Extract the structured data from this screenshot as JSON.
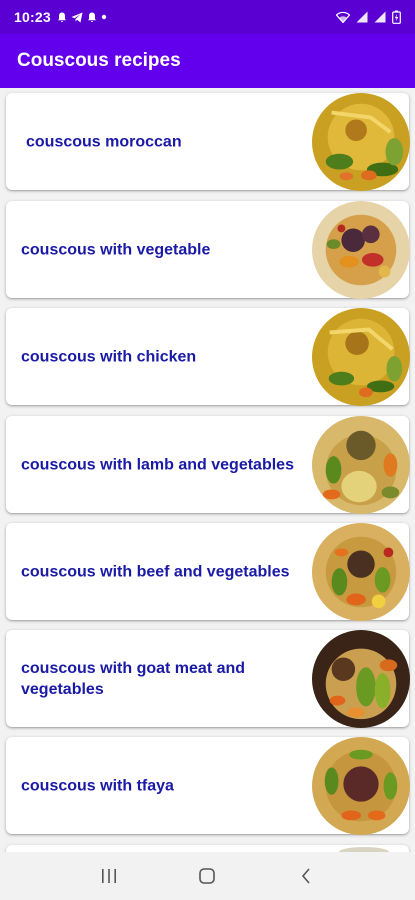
{
  "status_bar": {
    "time": "10:23",
    "notification_icons": [
      "bell-icon",
      "telegram-icon",
      "bell-icon",
      "dot-icon"
    ],
    "system_icons": [
      "wifi-icon",
      "signal-icon",
      "signal-icon",
      "battery-icon"
    ]
  },
  "app_bar": {
    "title": "Couscous recipes",
    "background": "#6200ee"
  },
  "recipes": [
    {
      "title": "couscous moroccan"
    },
    {
      "title": "couscous with vegetable"
    },
    {
      "title": "couscous with chicken"
    },
    {
      "title": "couscous with lamb and vegetables"
    },
    {
      "title": "couscous with beef and vegetables"
    },
    {
      "title": "couscous with goat meat and vegetables"
    },
    {
      "title": "couscous with tfaya"
    }
  ],
  "nav_bar": {
    "buttons": [
      "recent-apps-icon",
      "home-icon",
      "back-icon"
    ]
  },
  "colors": {
    "status_bar": "#5a00d2",
    "title_text": "#1a1aa6"
  }
}
